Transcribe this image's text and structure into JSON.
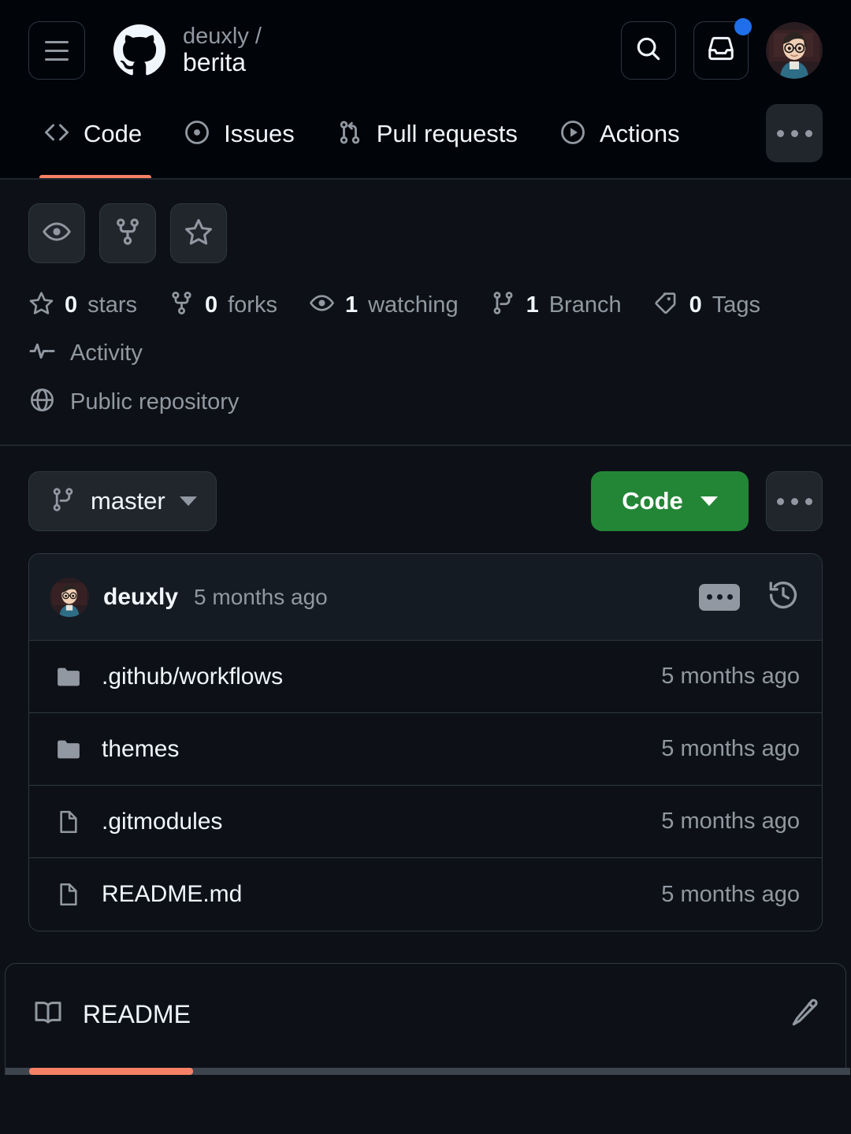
{
  "header": {
    "menu_icon": "hamburger-menu-icon",
    "logo_icon": "github-logo-icon",
    "owner": "deuxly /",
    "repo": "berita",
    "search_icon": "search-icon",
    "inbox_icon": "inbox-icon",
    "has_notification": true,
    "avatar_icon": "user-avatar"
  },
  "nav": {
    "tabs": [
      {
        "label": "Code",
        "icon": "code-icon",
        "active": true
      },
      {
        "label": "Issues",
        "icon": "issue-opened-icon",
        "active": false
      },
      {
        "label": "Pull requests",
        "icon": "git-pull-request-icon",
        "active": false
      },
      {
        "label": "Actions",
        "icon": "play-icon",
        "active": false
      }
    ],
    "more_label": "More",
    "active_color": "#f78166"
  },
  "repo_actions": [
    {
      "name": "watch-button",
      "icon": "eye-icon"
    },
    {
      "name": "fork-button",
      "icon": "repo-forked-icon"
    },
    {
      "name": "star-button",
      "icon": "star-icon"
    }
  ],
  "stats": [
    {
      "icon": "star-icon",
      "num": "0",
      "label": "stars"
    },
    {
      "icon": "repo-forked-icon",
      "num": "0",
      "label": "forks"
    },
    {
      "icon": "eye-icon",
      "num": "1",
      "label": "watching"
    },
    {
      "icon": "git-branch-icon",
      "num": "1",
      "label": "Branch"
    },
    {
      "icon": "tag-icon",
      "num": "0",
      "label": "Tags"
    }
  ],
  "meta": {
    "activity_label": "Activity",
    "activity_icon": "pulse-icon",
    "visibility_label": "Public repository",
    "visibility_icon": "globe-icon"
  },
  "branch_bar": {
    "branch_icon": "git-branch-icon",
    "branch_name": "master",
    "code_label": "Code",
    "code_color": "#238636",
    "more_label": "More options"
  },
  "commit": {
    "author": "deuxly",
    "time": "5 months ago",
    "msg_toggle_icon": "ellipsis-icon",
    "history_icon": "history-icon"
  },
  "files": [
    {
      "type": "folder",
      "icon": "file-directory-icon",
      "name": ".github/workflows",
      "time": "5 months ago"
    },
    {
      "type": "folder",
      "icon": "file-directory-icon",
      "name": "themes",
      "time": "5 months ago"
    },
    {
      "type": "file",
      "icon": "file-icon",
      "name": ".gitmodules",
      "time": "5 months ago"
    },
    {
      "type": "file",
      "icon": "file-icon",
      "name": "README.md",
      "time": "5 months ago"
    }
  ],
  "readme": {
    "label": "README",
    "book_icon": "book-icon",
    "edit_icon": "pencil-icon"
  }
}
